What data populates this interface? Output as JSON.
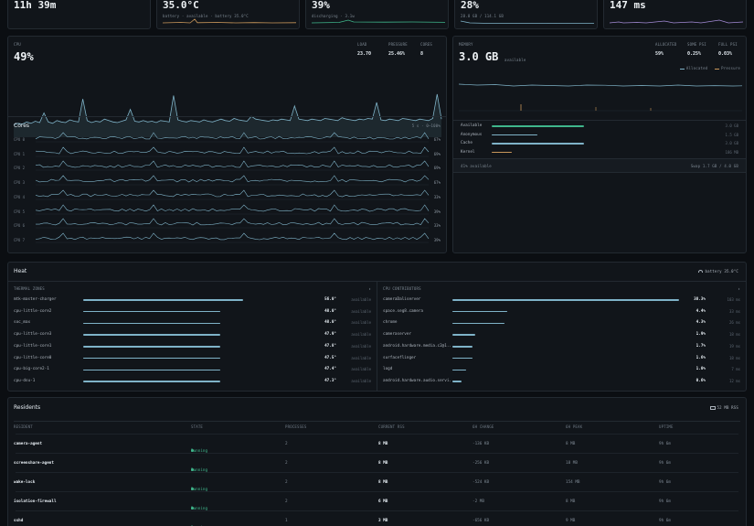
{
  "stats": [
    {
      "value": "11h 39m",
      "sub": ""
    },
    {
      "value": "35.0°C",
      "sub": "battery · available · battery 35.0°C"
    },
    {
      "value": "39%",
      "sub": "discharging · 3.1w"
    },
    {
      "value": "28%",
      "sub": "28.8 GB / 114.1 GB"
    },
    {
      "value": "147 ms",
      "sub": ""
    }
  ],
  "cpu": {
    "label": "CPU",
    "value": "49%",
    "metrics": [
      {
        "label": "LOAD",
        "value": "23.70"
      },
      {
        "label": "PRESSURE",
        "value": "25.46%"
      },
      {
        "label": "CORES",
        "value": "8"
      }
    ],
    "series": [
      0.18,
      0.2,
      0.19,
      0.22,
      0.2,
      0.23,
      0.21,
      0.35,
      0.22,
      0.2,
      0.24,
      0.22,
      0.21,
      0.25,
      0.23,
      0.22,
      0.55,
      0.24,
      0.21,
      0.23,
      0.22,
      0.26,
      0.24,
      0.22,
      0.21,
      0.23,
      0.25,
      0.4,
      0.23,
      0.22,
      0.24,
      0.22,
      0.23,
      0.21,
      0.24,
      0.23,
      0.22,
      0.6,
      0.25,
      0.23,
      0.22,
      0.24,
      0.23,
      0.22,
      0.25,
      0.23,
      0.22,
      0.24,
      0.26,
      0.24,
      0.23,
      0.27,
      0.25,
      0.24,
      0.23,
      0.3,
      0.26,
      0.25,
      0.24,
      0.23,
      0.25,
      0.24,
      0.26,
      0.25,
      0.24,
      0.45,
      0.26,
      0.25,
      0.24,
      0.26,
      0.25,
      0.24,
      0.27,
      0.26,
      0.25,
      0.24,
      0.28,
      0.26,
      0.25,
      0.24,
      0.26,
      0.25,
      0.27,
      0.26,
      0.5,
      0.25,
      0.24,
      0.26,
      0.25,
      0.24,
      0.27,
      0.26,
      0.25,
      0.24,
      0.26,
      0.25,
      0.24,
      0.27,
      0.62,
      0.26
    ]
  },
  "cores": {
    "label": "Cores",
    "range": "5 s · 0–100%",
    "items": [
      {
        "name": "CPU 0",
        "pct": "67%"
      },
      {
        "name": "CPU 1",
        "pct": "69%"
      },
      {
        "name": "CPU 2",
        "pct": "69%"
      },
      {
        "name": "CPU 3",
        "pct": "67%"
      },
      {
        "name": "CPU 4",
        "pct": "33%"
      },
      {
        "name": "CPU 5",
        "pct": "39%"
      },
      {
        "name": "CPU 6",
        "pct": "33%"
      },
      {
        "name": "CPU 7",
        "pct": "39%"
      }
    ]
  },
  "memory": {
    "label": "MEMORY",
    "value": "3.0 GB",
    "suffix": "available",
    "metrics": [
      {
        "label": "ALLOCATED",
        "value": "59%"
      },
      {
        "label": "SOME PSI",
        "value": "0.25%"
      },
      {
        "label": "FULL PSI",
        "value": "0.03%"
      }
    ],
    "legend": [
      {
        "name": "Allocated",
        "color": "#7fb3c8"
      },
      {
        "name": "Pressure",
        "color": "#c8965a"
      }
    ],
    "breakdown": [
      {
        "name": "Available",
        "value": "3.0 GB",
        "pct": 0.36,
        "color": "#3fb68b"
      },
      {
        "name": "Anonymous",
        "value": "1.5 GB",
        "pct": 0.18,
        "color": "#7fb3c8"
      },
      {
        "name": "Cache",
        "value": "3.0 GB",
        "pct": 0.36,
        "color": "#7fb3c8"
      },
      {
        "name": "Kernel",
        "value": "186 MB",
        "pct": 0.08,
        "color": "#c8965a"
      }
    ],
    "footer_left": "41% available",
    "footer_right": "Swap 1.7 GB / 4.0 GB"
  },
  "heat": {
    "title": "Heat",
    "badge": "battery 35.0°C",
    "thermal_header": "THERMAL ZONES",
    "thermal": [
      {
        "name": "mtk-master-charger",
        "value": "56.0°",
        "pct": 0.55,
        "status": "available"
      },
      {
        "name": "cpu-little-core2",
        "value": "48.0°",
        "pct": 0.47,
        "status": "available"
      },
      {
        "name": "soc_max",
        "value": "48.0°",
        "pct": 0.47,
        "status": "available"
      },
      {
        "name": "cpu-little-core3",
        "value": "47.9°",
        "pct": 0.47,
        "status": "available"
      },
      {
        "name": "cpu-little-core1",
        "value": "47.8°",
        "pct": 0.47,
        "status": "available"
      },
      {
        "name": "cpu-little-core0",
        "value": "47.5°",
        "pct": 0.47,
        "status": "available"
      },
      {
        "name": "cpu-big-core2-1",
        "value": "47.4°",
        "pct": 0.47,
        "status": "available"
      },
      {
        "name": "cpu-dsu-1",
        "value": "47.3°",
        "pct": 0.47,
        "status": "available"
      }
    ],
    "contrib_header": "CPU CONTRIBUTORS",
    "contributors": [
      {
        "name": "cameraDaliserver",
        "value": "38.3%",
        "pct": 1.0,
        "extra": "103 ms"
      },
      {
        "name": "space.seg8.camera",
        "value": "4.4%",
        "pct": 0.24,
        "extra": "33 ms"
      },
      {
        "name": "chrome",
        "value": "4.3%",
        "pct": 0.23,
        "extra": "26 ms"
      },
      {
        "name": "cameraserver",
        "value": "1.9%",
        "pct": 0.1,
        "extra": "18 ms"
      },
      {
        "name": "android.hardware.media.c2@1...",
        "value": "1.7%",
        "pct": 0.09,
        "extra": "19 ms"
      },
      {
        "name": "surfaceflinger",
        "value": "1.6%",
        "pct": 0.09,
        "extra": "18 ms"
      },
      {
        "name": "logd",
        "value": "1.0%",
        "pct": 0.06,
        "extra": "7 ms"
      },
      {
        "name": "android.hardware.audio.servi...",
        "value": "0.6%",
        "pct": 0.04,
        "extra": "12 ms"
      }
    ]
  },
  "residents": {
    "title": "Residents",
    "badge": "52 MB RSS",
    "columns": [
      "RESIDENT",
      "STATE",
      "PROCESSES",
      "CURRENT RSS",
      "6H CHANGE",
      "6H PEAK",
      "UPTIME"
    ],
    "rows": [
      {
        "name": "camera-agent",
        "state": "Running",
        "procs": "2",
        "rss": "8 MB",
        "change": "-136 KB",
        "peak": "8 MB",
        "uptime": "9h 6m"
      },
      {
        "name": "screenshare-agent",
        "state": "Running",
        "procs": "2",
        "rss": "8 MB",
        "change": "-256 KB",
        "peak": "18 MB",
        "uptime": "9h 6m"
      },
      {
        "name": "wake-lock",
        "state": "Running",
        "procs": "2",
        "rss": "8 MB",
        "change": "-524 KB",
        "peak": "154 MB",
        "uptime": "9h 6m"
      },
      {
        "name": "isolation-firewall",
        "state": "Running",
        "procs": "2",
        "rss": "6 MB",
        "change": "-2 MB",
        "peak": "8 MB",
        "uptime": "9h 6m"
      },
      {
        "name": "sshd",
        "state": "Running",
        "procs": "1",
        "rss": "3 MB",
        "change": "-656 KB",
        "peak": "9 MB",
        "uptime": "9h 6m"
      }
    ]
  }
}
